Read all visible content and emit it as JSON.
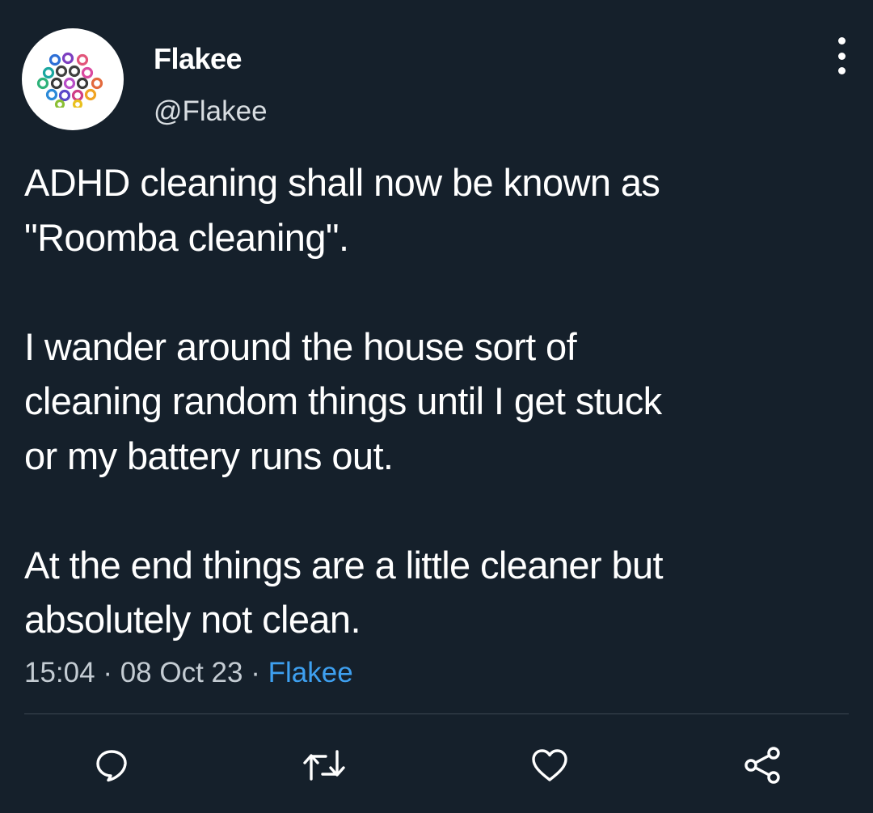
{
  "author": {
    "display_name": "Flakee",
    "handle": "@Flakee",
    "avatar_icon": "molecule-logo-icon"
  },
  "tweet": {
    "lines": [
      "ADHD cleaning shall now be known as",
      "\"Roomba cleaning\".",
      "",
      "I wander around the house sort of",
      "cleaning random things until I get stuck",
      "or my battery runs out.",
      "",
      "At the end things are a little cleaner but",
      "absolutely not clean."
    ]
  },
  "meta": {
    "time": "15:04",
    "separator": "·",
    "date": "08 Oct 23",
    "source": "Flakee"
  },
  "actions": {
    "reply_icon": "reply-icon",
    "retweet_icon": "retweet-icon",
    "like_icon": "heart-icon",
    "share_icon": "share-icon",
    "more_icon": "more-vertical-icon"
  },
  "colors": {
    "background": "#15202b",
    "text": "#ffffff",
    "secondary_text": "#c4ccd3",
    "link": "#3ea0f0",
    "divider": "#3c4753"
  }
}
